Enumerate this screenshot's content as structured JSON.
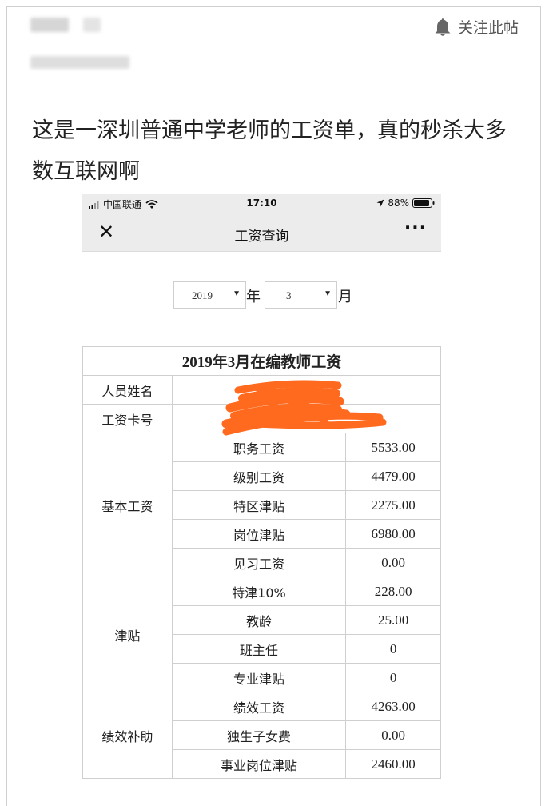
{
  "post": {
    "follow_label": "关注此帖",
    "title": "这是一深圳普通中学老师的工资单，真的秒杀大多数互联网啊"
  },
  "phone": {
    "carrier": "中国联通",
    "time": "17:10",
    "battery": "88%"
  },
  "page": {
    "nav_title": "工资查询",
    "close_icon": "close-icon",
    "more_icon": "more-icon"
  },
  "selector": {
    "year": "2019",
    "year_unit": "年",
    "month": "3",
    "month_unit": "月"
  },
  "table": {
    "title": "2019年3月在编教师工资",
    "name_label": "人员姓名",
    "card_label": "工资卡号",
    "groups": [
      {
        "label": "基本工资",
        "items": [
          {
            "name": "职务工资",
            "value": "5533.00"
          },
          {
            "name": "级别工资",
            "value": "4479.00"
          },
          {
            "name": "特区津贴",
            "value": "2275.00"
          },
          {
            "name": "岗位津贴",
            "value": "6980.00"
          },
          {
            "name": "见习工资",
            "value": "0.00"
          }
        ]
      },
      {
        "label": "津贴",
        "items": [
          {
            "name": "特津10%",
            "value": "228.00"
          },
          {
            "name": "教龄",
            "value": "25.00"
          },
          {
            "name": "班主任",
            "value": "0"
          },
          {
            "name": "专业津贴",
            "value": "0"
          }
        ]
      },
      {
        "label": "绩效补助",
        "items": [
          {
            "name": "绩效工资",
            "value": "4263.00"
          },
          {
            "name": "独生子女费",
            "value": "0.00"
          },
          {
            "name": "事业岗位津贴",
            "value": "2460.00"
          }
        ]
      }
    ]
  },
  "colors": {
    "scribble": "#ff6a1f",
    "nav_bg": "#ececec",
    "border": "#cfcfcf"
  }
}
